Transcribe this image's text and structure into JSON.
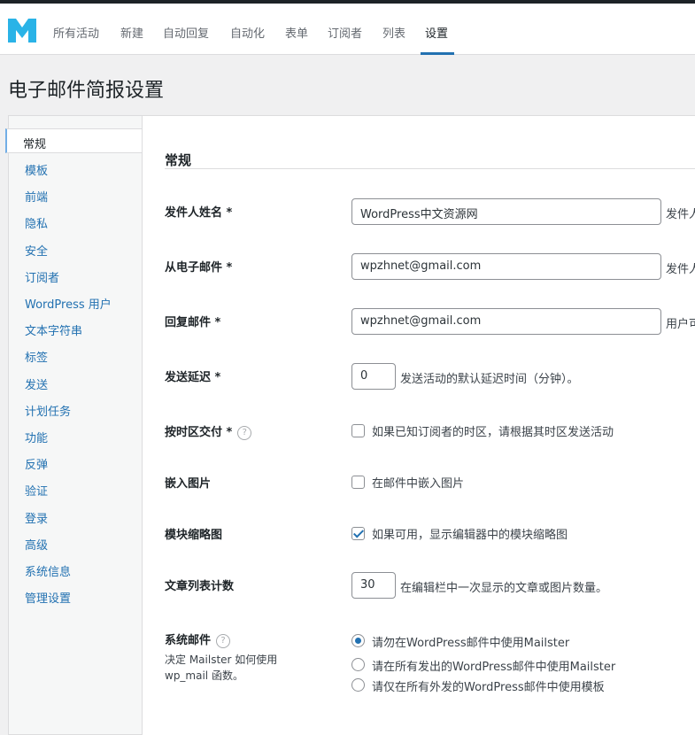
{
  "brand": {
    "logo_letter": "M",
    "color": "#2ab3e7"
  },
  "nav": {
    "items": [
      "所有活动",
      "新建",
      "自动回复",
      "自动化",
      "表单",
      "订阅者",
      "列表",
      "设置"
    ],
    "active": "设置"
  },
  "page_title": "电子邮件简报设置",
  "sidebar": {
    "items": [
      "常规",
      "模板",
      "前端",
      "隐私",
      "安全",
      "订阅者",
      "WordPress 用户",
      "文本字符串",
      "标签",
      "发送",
      "计划任务",
      "功能",
      "反弹",
      "验证",
      "登录",
      "高级",
      "系统信息",
      "管理设置"
    ]
  },
  "section": {
    "title": "常规"
  },
  "fields": {
    "from_name": {
      "label": "发件人姓名 *",
      "value": "WordPress中文资源网",
      "desc": "发件人"
    },
    "from_email": {
      "label": "从电子邮件 *",
      "value": "wpzhnet@gmail.com",
      "desc": "发件人"
    },
    "reply_to": {
      "label": "回复邮件 *",
      "value": "wpzhnet@gmail.com",
      "desc": "用户可"
    },
    "send_delay": {
      "label": "发送延迟 *",
      "value": "0",
      "desc": "发送活动的默认延迟时间（分钟）。"
    },
    "timezone": {
      "label": "按时区交付 *",
      "help": "?",
      "checked": false,
      "desc": "如果已知订阅者的时区，请根据其时区发送活动"
    },
    "embed_images": {
      "label": "嵌入图片",
      "checked": false,
      "desc": "在邮件中嵌入图片"
    },
    "module_thumbs": {
      "label": "模块缩略图",
      "checked": true,
      "desc": "如果可用，显示编辑器中的模块缩略图"
    },
    "post_count": {
      "label": "文章列表计数",
      "value": "30",
      "desc": "在编辑栏中一次显示的文章或图片数量。"
    },
    "system_mail": {
      "label": "系统邮件",
      "help": "?",
      "sub": "决定 Mailster 如何使用 wp_mail 函数。",
      "options": [
        "请勿在WordPress邮件中使用Mailster",
        "请在所有发出的WordPress邮件中使用Mailster",
        "请仅在所有外发的WordPress邮件中使用模板"
      ],
      "selected": 0
    }
  }
}
